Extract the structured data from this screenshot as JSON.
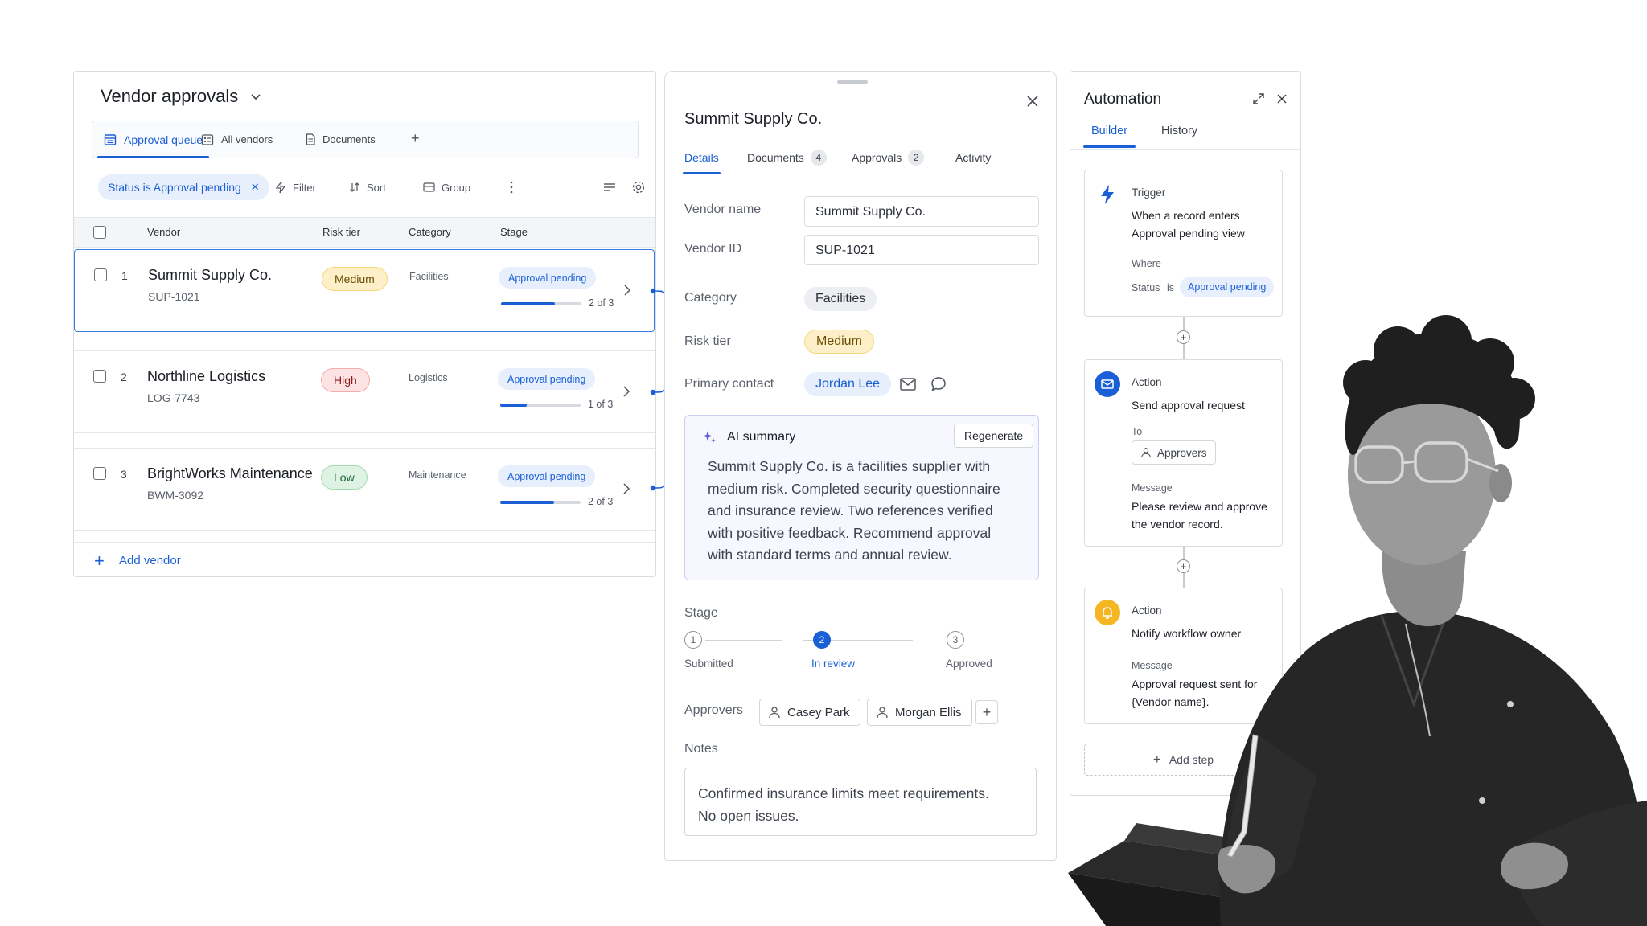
{
  "vendor_panel": {
    "title": "Vendor approvals",
    "tabs": [
      {
        "label": "Approval queue",
        "icon": "table-icon",
        "active": true
      },
      {
        "label": "All vendors",
        "icon": "list-icon",
        "active": false
      },
      {
        "label": "Documents",
        "icon": "document-icon",
        "active": false
      }
    ],
    "filter_chip": "Status is Approval pending",
    "toolbar": {
      "filter": "Filter",
      "sort": "Sort",
      "group": "Group"
    },
    "columns": [
      "Vendor",
      "Risk tier",
      "Category",
      "Stage"
    ],
    "rows": [
      {
        "num": "1",
        "name": "Summit Supply Co.",
        "id": "SUP-1021",
        "risk": "Medium",
        "category": "Facilities",
        "stage": "Approval pending",
        "progress": 0.67,
        "count": "2 of 3",
        "selected": true
      },
      {
        "num": "2",
        "name": "Northline Logistics",
        "id": "LOG-7743",
        "risk": "High",
        "category": "Logistics",
        "stage": "Approval pending",
        "progress": 0.33,
        "count": "1 of 3",
        "selected": false
      },
      {
        "num": "3",
        "name": "BrightWorks Maintenance",
        "id": "BWM-3092",
        "risk": "Low",
        "category": "Maintenance",
        "stage": "Approval pending",
        "progress": 0.67,
        "count": "2 of 3",
        "selected": false
      }
    ],
    "add_vendor": "Add vendor"
  },
  "details": {
    "title": "Summit Supply Co.",
    "tabs": [
      {
        "label": "Details",
        "count": "",
        "active": true
      },
      {
        "label": "Documents",
        "count": "4",
        "active": false
      },
      {
        "label": "Approvals",
        "count": "2",
        "active": false
      },
      {
        "label": "Activity",
        "count": "",
        "active": false
      }
    ],
    "fields": {
      "vendor_name_label": "Vendor name",
      "vendor_name": "Summit Supply Co.",
      "vendor_id_label": "Vendor ID",
      "vendor_id": "SUP-1021",
      "category_label": "Category",
      "category": "Facilities",
      "risk_label": "Risk tier",
      "risk": "Medium",
      "contact_label": "Primary contact",
      "contact": "Jordan Lee"
    },
    "ai": {
      "title": "AI summary",
      "regenerate": "Regenerate",
      "lines": [
        "Summit Supply Co. is a facilities supplier with",
        "medium risk. Completed security questionnaire",
        "and insurance review. Two references verified",
        "with positive feedback. Recommend approval",
        "with standard terms and annual review."
      ]
    },
    "stage_label": "Stage",
    "steps": [
      {
        "n": "1",
        "label": "Submitted"
      },
      {
        "n": "2",
        "label": "In review"
      },
      {
        "n": "3",
        "label": "Approved"
      }
    ],
    "current_step": 2,
    "approvers_label": "Approvers",
    "approvers": [
      "Casey Park",
      "Morgan Ellis"
    ],
    "notes_label": "Notes",
    "notes_lines": [
      "Confirmed insurance limits meet requirements.",
      "No open issues."
    ]
  },
  "automation": {
    "title": "Automation",
    "tabs": [
      "Builder",
      "History"
    ],
    "trigger": {
      "type": "Trigger",
      "text_lines": [
        "When a record enters",
        "Approval pending view"
      ],
      "where": "Where",
      "cond_field": "Status",
      "cond_op": "is",
      "cond_value": "Approval pending"
    },
    "action1": {
      "type": "Action",
      "text": "Send approval request",
      "to_label": "To",
      "to": "Approvers",
      "message_label": "Message",
      "message_lines": [
        "Please review and approve",
        "the vendor record."
      ]
    },
    "action2": {
      "type": "Action",
      "text": "Notify workflow owner",
      "message_label": "Message",
      "message_lines": [
        "Approval request sent for",
        "{Vendor name}."
      ]
    },
    "add_step": "Add step"
  },
  "colors": {
    "accent": "#1a5fd6",
    "medium_bg": "#fdf0c8",
    "high_bg": "#fde3e3",
    "low_bg": "#def3e4",
    "trigger_icon": "lightning-icon",
    "action_mail_bg": "#1a5fd6",
    "action_bell_bg": "#f5b623"
  }
}
